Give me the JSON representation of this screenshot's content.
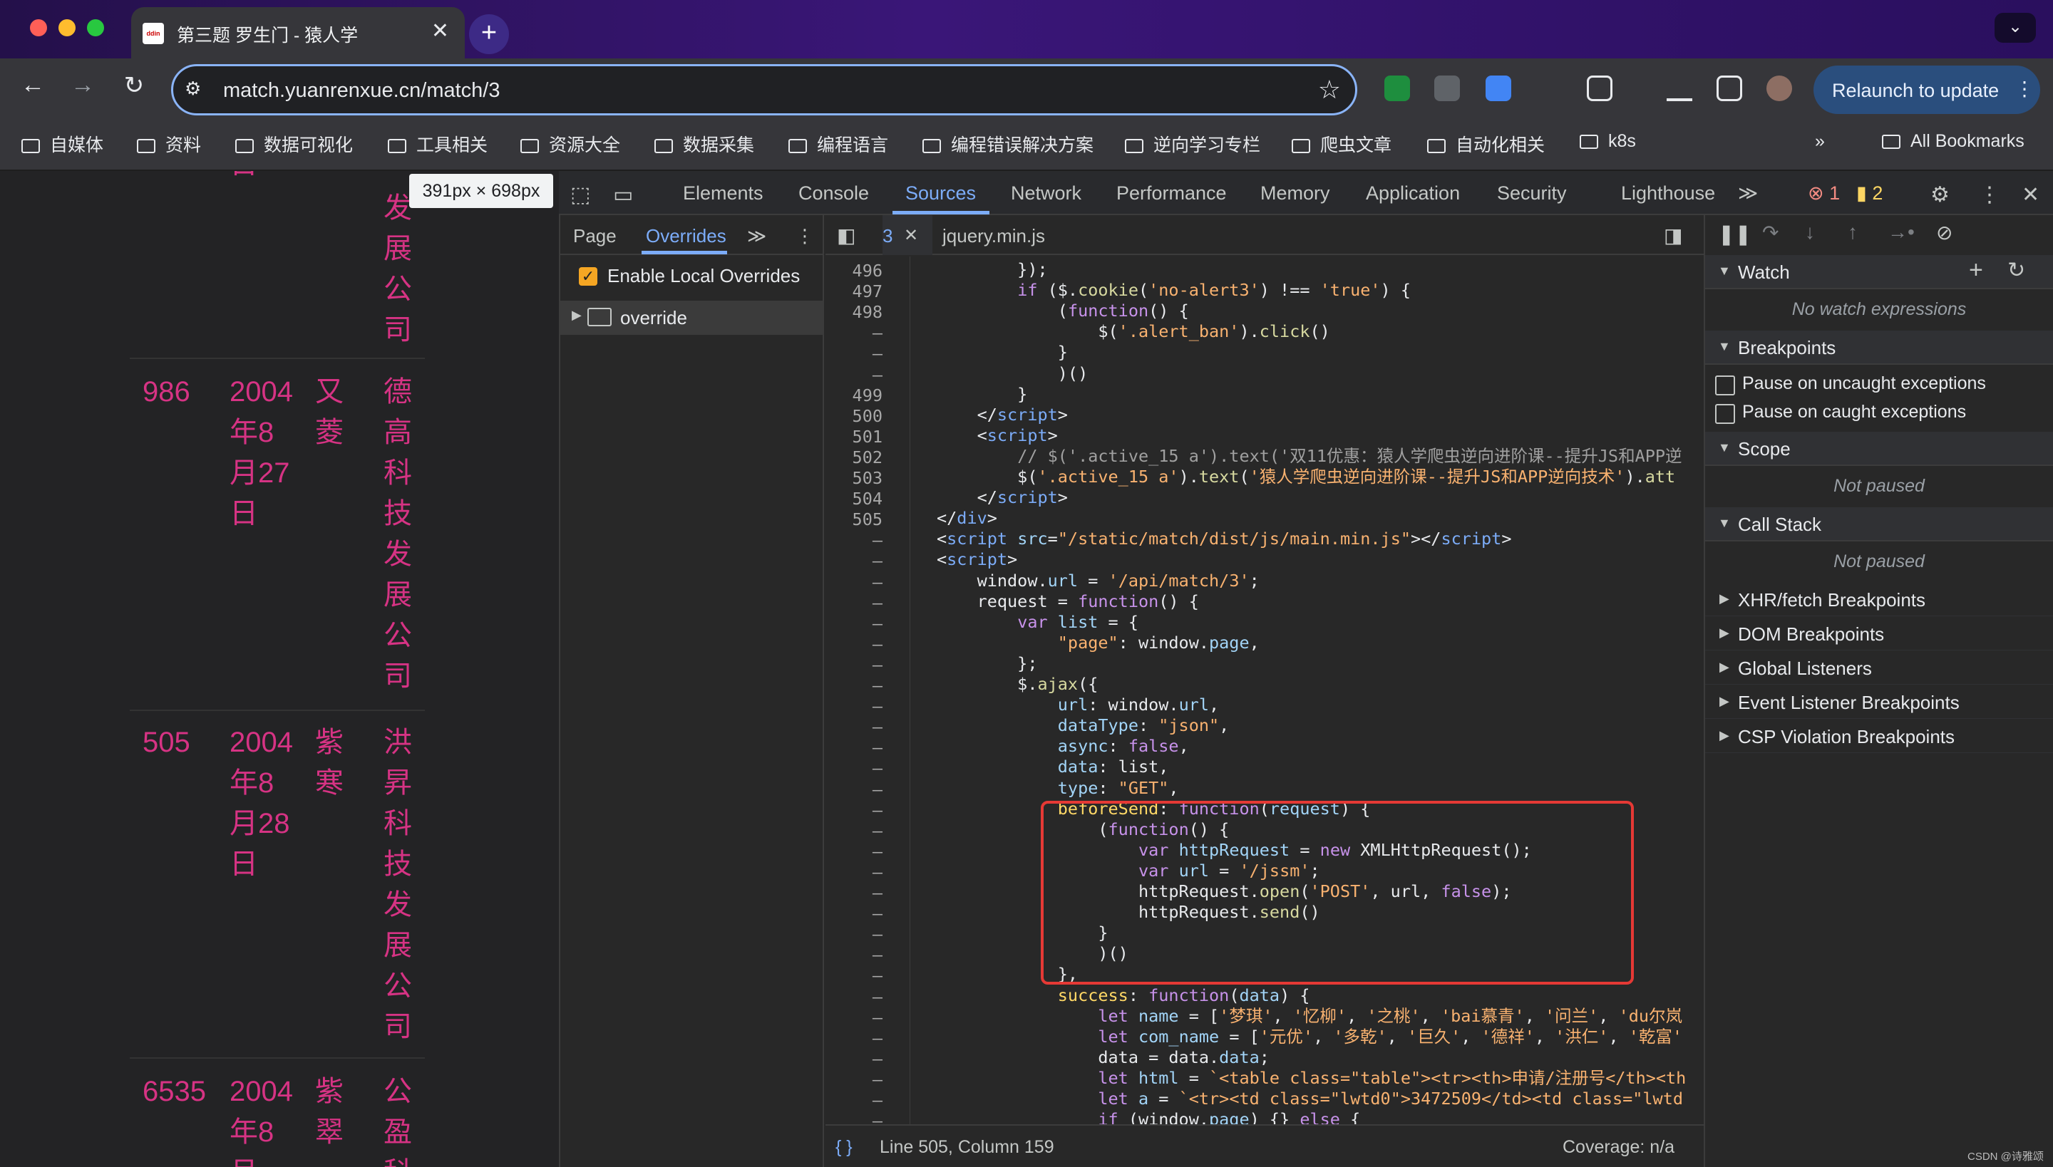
{
  "window": {
    "tab_title": "第三题 罗生门 - 猿人学",
    "tab_favicon_text": "ddin",
    "tab_close": "✕",
    "new_tab": "+",
    "tab_menu": "⌄"
  },
  "toolbar": {
    "url": "match.yuanrenxue.cn/match/3",
    "relaunch_label": "Relaunch to update"
  },
  "bookmarks": {
    "items": [
      "自媒体",
      "资料",
      "数据可视化",
      "工具相关",
      "资源大全",
      "数据采集",
      "编程语言",
      "编程错误解决方案",
      "逆向学习专栏",
      "爬虫文章",
      "自动化相关",
      "k8s"
    ],
    "overflow": "»",
    "all_bookmarks": "All Bookmarks"
  },
  "page": {
    "dimension_tooltip": "391px × 698px",
    "rows": [
      {
        "num": "",
        "date": "日",
        "name": "",
        "company": "发展公司"
      },
      {
        "num": "986",
        "date": "2004年8月27日",
        "name": "又菱",
        "company": "德高科技发展公司"
      },
      {
        "num": "505",
        "date": "2004年8月28日",
        "name": "紫寒",
        "company": "洪昇科技发展公司"
      },
      {
        "num": "6535",
        "date": "2004年8月",
        "name": "紫翠",
        "company": "公盈科"
      }
    ]
  },
  "devtools": {
    "tabs": [
      "Elements",
      "Console",
      "Sources",
      "Network",
      "Performance",
      "Memory",
      "Application",
      "Security",
      "Lighthouse"
    ],
    "active_tab": "Sources",
    "more_tabs": "≫",
    "error_count": "1",
    "warning_count": "2",
    "navigator": {
      "tabs": [
        "Page",
        "Overrides"
      ],
      "more": "≫",
      "enable_label": "Enable Local Overrides",
      "folder": "override"
    },
    "editor": {
      "tabs": [
        {
          "label": "3",
          "close": "✕"
        },
        {
          "label": "jquery.min.js"
        }
      ],
      "status_left": "Line 505, Column 159",
      "status_right": "Coverage: n/a",
      "format_icon": "{ }"
    },
    "debugger": {
      "watch": "Watch",
      "no_watch": "No watch expressions",
      "breakpoints": "Breakpoints",
      "pause_uncaught": "Pause on uncaught exceptions",
      "pause_caught": "Pause on caught exceptions",
      "scope": "Scope",
      "not_paused": "Not paused",
      "call_stack": "Call Stack",
      "not_paused_2": "Not paused",
      "collapsed": [
        "XHR/fetch Breakpoints",
        "DOM Breakpoints",
        "Global Listeners",
        "Event Listener Breakpoints",
        "CSP Violation Breakpoints"
      ]
    }
  },
  "code_lines": [
    {
      "ln": "496",
      "html": "        });"
    },
    {
      "ln": "497",
      "html": "        <span class='k'>if</span> ($.<span class='f'>cookie</span>(<span class='s'>'no-alert3'</span>) !== <span class='s'>'true'</span>) {"
    },
    {
      "ln": "498",
      "html": "            (<span class='k'>function</span>() {"
    },
    {
      "ln": "–",
      "html": "                $(<span class='s'>'.alert_ban'</span>).<span class='f'>click</span>()"
    },
    {
      "ln": "–",
      "html": "            }"
    },
    {
      "ln": "–",
      "html": "            )()"
    },
    {
      "ln": "499",
      "html": "        }"
    },
    {
      "ln": "500",
      "html": "    &lt;/<span class='t'>script</span>&gt;"
    },
    {
      "ln": "501",
      "html": "    &lt;<span class='t'>script</span>&gt;"
    },
    {
      "ln": "502",
      "html": "        <span class='c'>// $('.active_15 a').text('双11优惠：猿人学爬虫逆向进阶课--提升JS和APP逆</span>"
    },
    {
      "ln": "503",
      "html": "        $(<span class='s'>'.active_15 a'</span>).<span class='f'>text</span>(<span class='s'>'猿人学爬虫逆向进阶课--提升JS和APP逆向技术'</span>).<span class='f'>att</span>"
    },
    {
      "ln": "504",
      "html": "    &lt;/<span class='t'>script</span>&gt;"
    },
    {
      "ln": "505",
      "html": "&lt;/<span class='t'>div</span>&gt;"
    },
    {
      "ln": "–",
      "html": "&lt;<span class='t'>script</span> <span class='p'>src</span>=<span class='s'>\"/static/match/dist/js/main.min.js\"</span>&gt;&lt;/<span class='t'>script</span>&gt;"
    },
    {
      "ln": "–",
      "html": "&lt;<span class='t'>script</span>&gt;"
    },
    {
      "ln": "–",
      "html": "    window.<span class='p'>url</span> = <span class='s'>'/api/match/3'</span>;"
    },
    {
      "ln": "–",
      "html": "    request = <span class='k'>function</span>() {"
    },
    {
      "ln": "–",
      "html": "        <span class='k'>var</span> <span class='p'>list</span> = {"
    },
    {
      "ln": "–",
      "html": "            <span class='s'>\"page\"</span>: window.<span class='p'>page</span>,"
    },
    {
      "ln": "–",
      "html": "        };"
    },
    {
      "ln": "–",
      "html": "        $.<span class='f'>ajax</span>({"
    },
    {
      "ln": "–",
      "html": "            <span class='p'>url</span>: window.<span class='p'>url</span>,"
    },
    {
      "ln": "–",
      "html": "            <span class='p'>dataType</span>: <span class='s'>\"json\"</span>,"
    },
    {
      "ln": "–",
      "html": "            <span class='p'>async</span>: <span class='k'>false</span>,"
    },
    {
      "ln": "–",
      "html": "            <span class='p'>data</span>: list,"
    },
    {
      "ln": "–",
      "html": "            <span class='p'>type</span>: <span class='s'>\"GET\"</span>,"
    },
    {
      "ln": "–",
      "html": "            <span class='y'>beforeSend</span>: <span class='k'>function</span>(<span class='p'>request</span>) {"
    },
    {
      "ln": "–",
      "html": "                (<span class='k'>function</span>() {"
    },
    {
      "ln": "–",
      "html": "                    <span class='k'>var</span> <span class='p'>httpRequest</span> = <span class='k'>new</span> XMLHttpRequest();"
    },
    {
      "ln": "–",
      "html": "                    <span class='k'>var</span> <span class='p'>url</span> = <span class='s'>'/jssm'</span>;"
    },
    {
      "ln": "–",
      "html": "                    httpRequest.<span class='f'>open</span>(<span class='s'>'POST'</span>, url, <span class='k'>false</span>);"
    },
    {
      "ln": "–",
      "html": "                    httpRequest.<span class='f'>send</span>()"
    },
    {
      "ln": "–",
      "html": "                }"
    },
    {
      "ln": "–",
      "html": "                )()"
    },
    {
      "ln": "–",
      "html": "            },"
    },
    {
      "ln": "–",
      "html": "            <span class='y'>success</span>: <span class='k'>function</span>(<span class='p'>data</span>) {"
    },
    {
      "ln": "–",
      "html": "                <span class='k'>let</span> <span class='p'>name</span> = [<span class='s'>'梦琪'</span>, <span class='s'>'忆柳'</span>, <span class='s'>'之桃'</span>, <span class='s'>'bai慕青'</span>, <span class='s'>'问兰'</span>, <span class='s'>'du尔岚</span>"
    },
    {
      "ln": "–",
      "html": "                <span class='k'>let</span> <span class='p'>com_name</span> = [<span class='s'>'元优'</span>, <span class='s'>'多乾'</span>, <span class='s'>'巨久'</span>, <span class='s'>'德祥'</span>, <span class='s'>'洪仁'</span>, <span class='s'>'乾富'</span>"
    },
    {
      "ln": "–",
      "html": "                data = data.<span class='p'>data</span>;"
    },
    {
      "ln": "–",
      "html": "                <span class='k'>let</span> <span class='p'>html</span> = <span class='s'>`&lt;table class=\"table\"&gt;&lt;tr&gt;&lt;th&gt;申请/注册号&lt;/th&gt;&lt;th</span>"
    },
    {
      "ln": "–",
      "html": "                <span class='k'>let</span> <span class='p'>a</span> = <span class='s'>`&lt;tr&gt;&lt;td class=\"lwtd0\"&gt;3472509&lt;/td&gt;&lt;td class=\"lwtd</span>"
    },
    {
      "ln": "–",
      "html": "                <span class='k'>if</span> (window.<span class='p'>page</span>) {} <span class='k'>else</span> {"
    }
  ],
  "footer": {
    "watermark": "CSDN @诗雅颂"
  },
  "colors": {
    "accent": "#7cacf8",
    "page_text": "#d63384",
    "highlight_box": "#e53935"
  }
}
